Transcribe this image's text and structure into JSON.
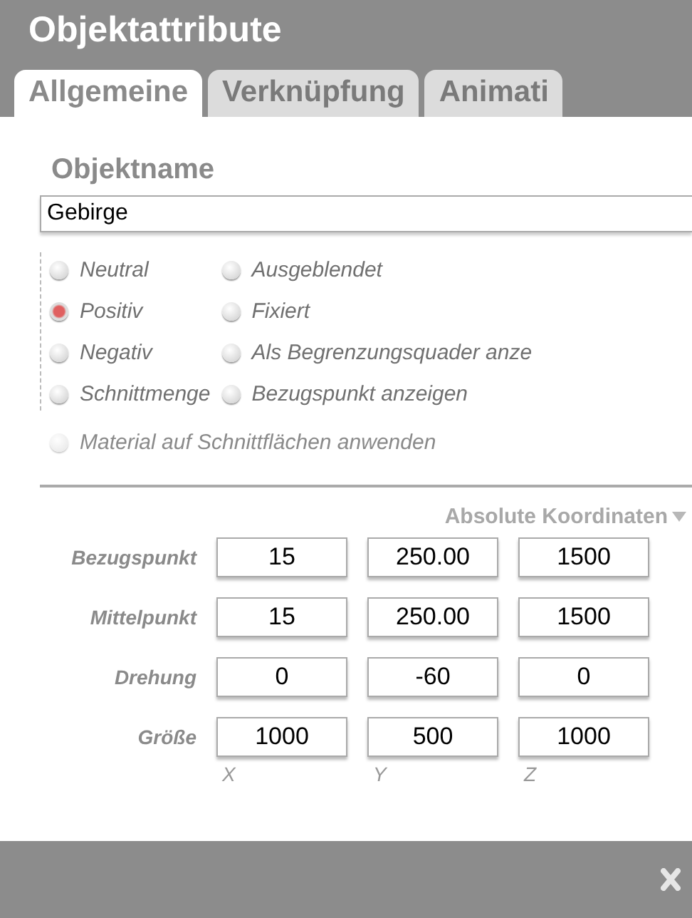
{
  "window": {
    "title": "Objektattribute"
  },
  "tabs": [
    {
      "label": "Allgemeine",
      "selected": true
    },
    {
      "label": "Verknüpfung",
      "selected": false
    },
    {
      "label": "Animati",
      "selected": false
    }
  ],
  "object_name": {
    "label": "Objektname",
    "value": "Gebirge"
  },
  "mode_options": [
    {
      "label": "Neutral",
      "selected": false
    },
    {
      "label": "Positiv",
      "selected": true
    },
    {
      "label": "Negativ",
      "selected": false
    },
    {
      "label": "Schnittmenge",
      "selected": false
    }
  ],
  "display_options": [
    {
      "label": "Ausgeblendet",
      "checked": false
    },
    {
      "label": "Fixiert",
      "checked": false
    },
    {
      "label": "Als Begrenzungsquader anze",
      "checked": false
    },
    {
      "label": "Bezugspunkt anzeigen",
      "checked": false
    }
  ],
  "material_option": {
    "label": "Material auf Schnittflächen anwenden",
    "checked": false,
    "disabled": true
  },
  "coordinates_dropdown": {
    "value": "Absolute Koordinaten"
  },
  "coordinate_rows": [
    {
      "label": "Bezugspunkt",
      "values": [
        "15",
        "250.00",
        "1500"
      ]
    },
    {
      "label": "Mittelpunkt",
      "values": [
        "15",
        "250.00",
        "1500"
      ]
    },
    {
      "label": "Drehung",
      "values": [
        "0",
        "-60",
        "0"
      ]
    },
    {
      "label": "Größe",
      "values": [
        "1000",
        "500",
        "1000"
      ]
    }
  ],
  "axis_labels": [
    "X",
    "Y",
    "Z"
  ]
}
